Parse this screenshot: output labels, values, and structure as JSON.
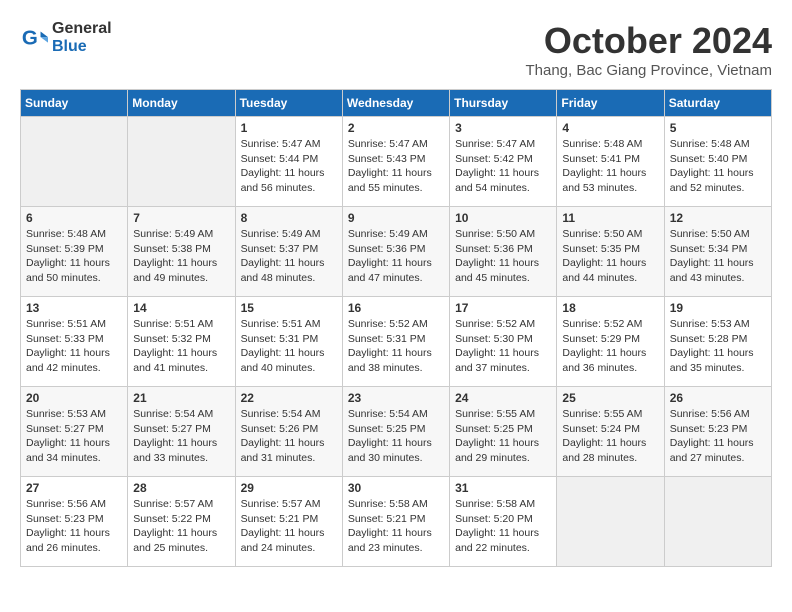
{
  "header": {
    "logo": {
      "general": "General",
      "blue": "Blue"
    },
    "title": "October 2024",
    "subtitle": "Thang, Bac Giang Province, Vietnam"
  },
  "columns": [
    "Sunday",
    "Monday",
    "Tuesday",
    "Wednesday",
    "Thursday",
    "Friday",
    "Saturday"
  ],
  "weeks": [
    [
      {
        "day": "",
        "info": ""
      },
      {
        "day": "",
        "info": ""
      },
      {
        "day": "1",
        "info": "Sunrise: 5:47 AM\nSunset: 5:44 PM\nDaylight: 11 hours\nand 56 minutes."
      },
      {
        "day": "2",
        "info": "Sunrise: 5:47 AM\nSunset: 5:43 PM\nDaylight: 11 hours\nand 55 minutes."
      },
      {
        "day": "3",
        "info": "Sunrise: 5:47 AM\nSunset: 5:42 PM\nDaylight: 11 hours\nand 54 minutes."
      },
      {
        "day": "4",
        "info": "Sunrise: 5:48 AM\nSunset: 5:41 PM\nDaylight: 11 hours\nand 53 minutes."
      },
      {
        "day": "5",
        "info": "Sunrise: 5:48 AM\nSunset: 5:40 PM\nDaylight: 11 hours\nand 52 minutes."
      }
    ],
    [
      {
        "day": "6",
        "info": "Sunrise: 5:48 AM\nSunset: 5:39 PM\nDaylight: 11 hours\nand 50 minutes."
      },
      {
        "day": "7",
        "info": "Sunrise: 5:49 AM\nSunset: 5:38 PM\nDaylight: 11 hours\nand 49 minutes."
      },
      {
        "day": "8",
        "info": "Sunrise: 5:49 AM\nSunset: 5:37 PM\nDaylight: 11 hours\nand 48 minutes."
      },
      {
        "day": "9",
        "info": "Sunrise: 5:49 AM\nSunset: 5:36 PM\nDaylight: 11 hours\nand 47 minutes."
      },
      {
        "day": "10",
        "info": "Sunrise: 5:50 AM\nSunset: 5:36 PM\nDaylight: 11 hours\nand 45 minutes."
      },
      {
        "day": "11",
        "info": "Sunrise: 5:50 AM\nSunset: 5:35 PM\nDaylight: 11 hours\nand 44 minutes."
      },
      {
        "day": "12",
        "info": "Sunrise: 5:50 AM\nSunset: 5:34 PM\nDaylight: 11 hours\nand 43 minutes."
      }
    ],
    [
      {
        "day": "13",
        "info": "Sunrise: 5:51 AM\nSunset: 5:33 PM\nDaylight: 11 hours\nand 42 minutes."
      },
      {
        "day": "14",
        "info": "Sunrise: 5:51 AM\nSunset: 5:32 PM\nDaylight: 11 hours\nand 41 minutes."
      },
      {
        "day": "15",
        "info": "Sunrise: 5:51 AM\nSunset: 5:31 PM\nDaylight: 11 hours\nand 40 minutes."
      },
      {
        "day": "16",
        "info": "Sunrise: 5:52 AM\nSunset: 5:31 PM\nDaylight: 11 hours\nand 38 minutes."
      },
      {
        "day": "17",
        "info": "Sunrise: 5:52 AM\nSunset: 5:30 PM\nDaylight: 11 hours\nand 37 minutes."
      },
      {
        "day": "18",
        "info": "Sunrise: 5:52 AM\nSunset: 5:29 PM\nDaylight: 11 hours\nand 36 minutes."
      },
      {
        "day": "19",
        "info": "Sunrise: 5:53 AM\nSunset: 5:28 PM\nDaylight: 11 hours\nand 35 minutes."
      }
    ],
    [
      {
        "day": "20",
        "info": "Sunrise: 5:53 AM\nSunset: 5:27 PM\nDaylight: 11 hours\nand 34 minutes."
      },
      {
        "day": "21",
        "info": "Sunrise: 5:54 AM\nSunset: 5:27 PM\nDaylight: 11 hours\nand 33 minutes."
      },
      {
        "day": "22",
        "info": "Sunrise: 5:54 AM\nSunset: 5:26 PM\nDaylight: 11 hours\nand 31 minutes."
      },
      {
        "day": "23",
        "info": "Sunrise: 5:54 AM\nSunset: 5:25 PM\nDaylight: 11 hours\nand 30 minutes."
      },
      {
        "day": "24",
        "info": "Sunrise: 5:55 AM\nSunset: 5:25 PM\nDaylight: 11 hours\nand 29 minutes."
      },
      {
        "day": "25",
        "info": "Sunrise: 5:55 AM\nSunset: 5:24 PM\nDaylight: 11 hours\nand 28 minutes."
      },
      {
        "day": "26",
        "info": "Sunrise: 5:56 AM\nSunset: 5:23 PM\nDaylight: 11 hours\nand 27 minutes."
      }
    ],
    [
      {
        "day": "27",
        "info": "Sunrise: 5:56 AM\nSunset: 5:23 PM\nDaylight: 11 hours\nand 26 minutes."
      },
      {
        "day": "28",
        "info": "Sunrise: 5:57 AM\nSunset: 5:22 PM\nDaylight: 11 hours\nand 25 minutes."
      },
      {
        "day": "29",
        "info": "Sunrise: 5:57 AM\nSunset: 5:21 PM\nDaylight: 11 hours\nand 24 minutes."
      },
      {
        "day": "30",
        "info": "Sunrise: 5:58 AM\nSunset: 5:21 PM\nDaylight: 11 hours\nand 23 minutes."
      },
      {
        "day": "31",
        "info": "Sunrise: 5:58 AM\nSunset: 5:20 PM\nDaylight: 11 hours\nand 22 minutes."
      },
      {
        "day": "",
        "info": ""
      },
      {
        "day": "",
        "info": ""
      }
    ]
  ]
}
